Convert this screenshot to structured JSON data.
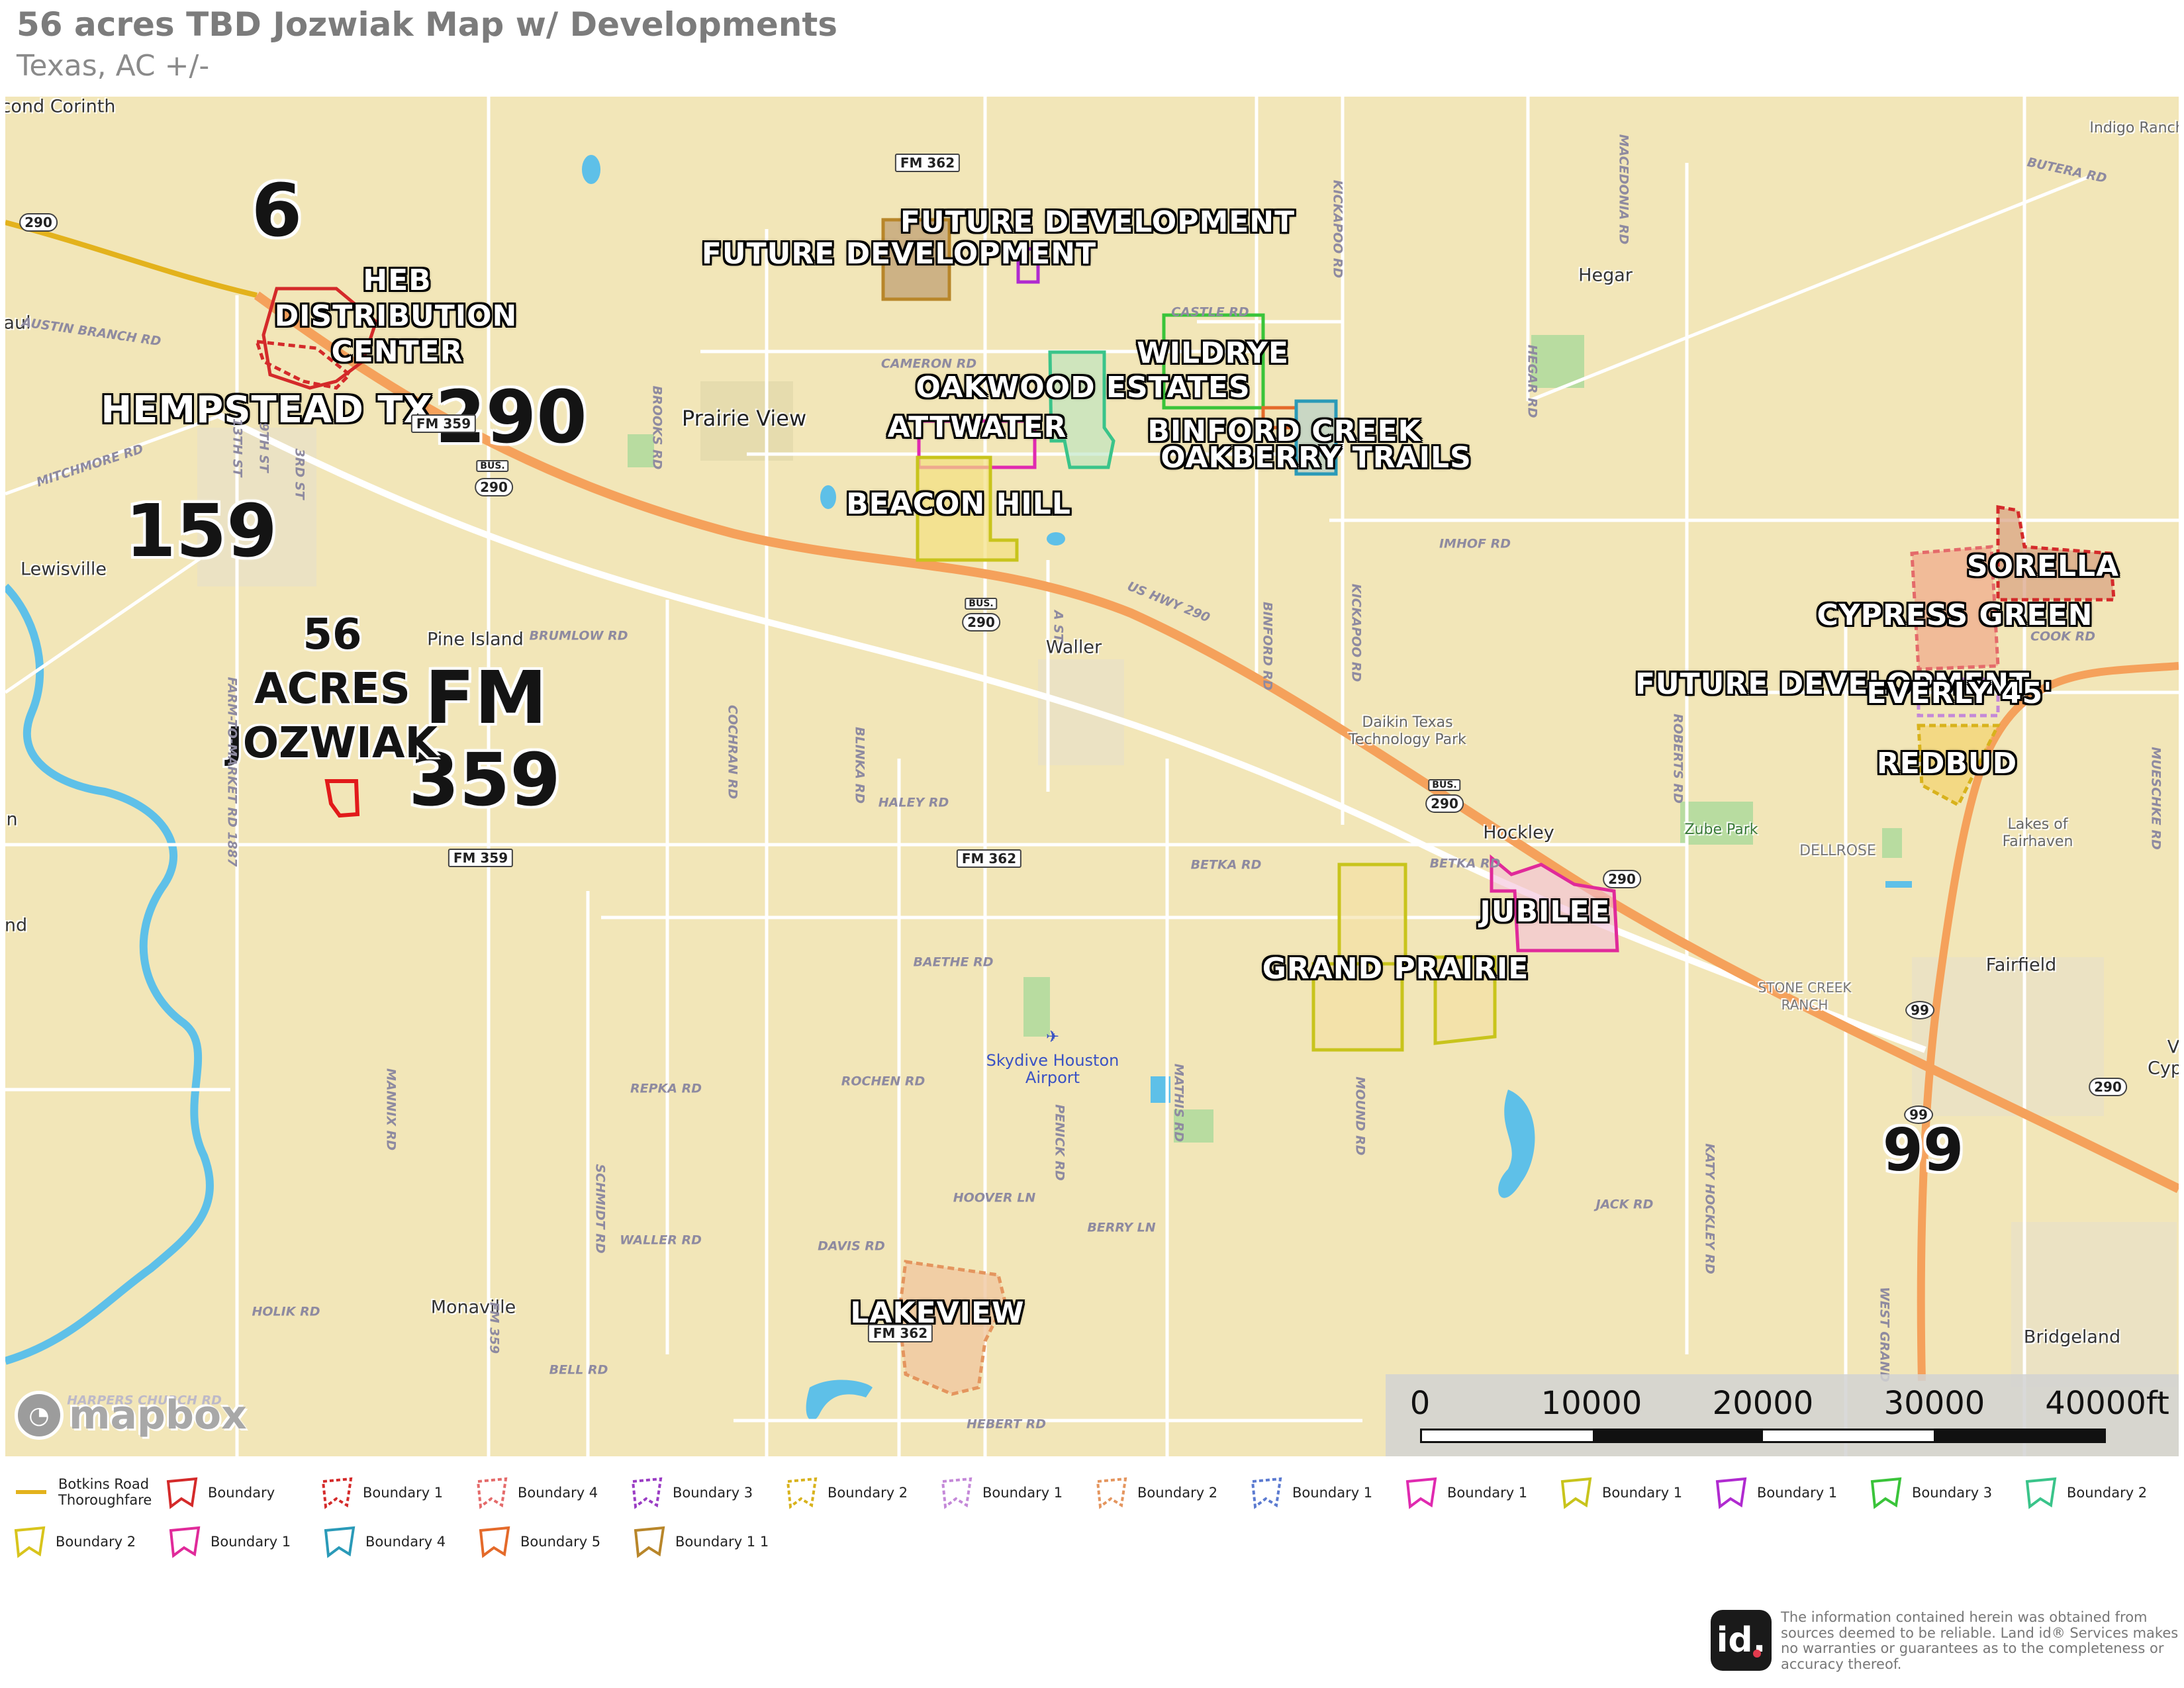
{
  "header": {
    "title": "56 acres TBD Jozwiak Map w/ Developments",
    "subtitle": "Texas,  AC +/-"
  },
  "map": {
    "colors": {
      "land": "#f2e6b8",
      "water": "#5ec0e8",
      "highway": "#f5a15b",
      "road": "#ffffff",
      "park": "#b8dca0"
    },
    "development_labels": [
      "FUTURE DEVELOPMENT",
      "FUTURE DEVELOPMENT",
      "HEB",
      "DISTRIBUTION",
      "CENTER",
      "HEMPSTEAD TX",
      "WILDRYE",
      "OAKWOOD ESTATES",
      "ATTWATER",
      "BINFORD CREEK",
      "OAKBERRY TRAILS",
      "BEACON HILL",
      "SORELLA",
      "CYPRESS GREEN",
      "FUTURE DEVELOPMENT",
      "EVERLY 45'",
      "REDBUD",
      "JUBILEE",
      "GRAND PRAIRIE",
      "LAKEVIEW"
    ],
    "highway_labels": [
      "6",
      "290",
      "159",
      "FM",
      "359",
      "99"
    ],
    "subject_label": [
      "56",
      "ACRES",
      "JOZWIAK"
    ],
    "place_labels": [
      "cond Corinth",
      "Hegar",
      "Indigo Ranch",
      "Prairie View",
      "Lewisville",
      "Pine Island",
      "Waller",
      "Daikin Texas",
      "Technology Park",
      "Hockley",
      "Zube Park",
      "Lakes of",
      "Fairhaven",
      "Fairfield",
      "Monaville",
      "Bridgeland",
      "DELLROSE",
      "STONE CREEK",
      "RANCH",
      "aul",
      "n",
      "nd",
      "Cyp",
      "V"
    ],
    "road_labels": [
      "AUSTIN BRANCH RD",
      "MITCHMORE RD",
      "CAMERON RD",
      "BROOKS RD",
      "BRUMLOW RD",
      "COCHRAN RD",
      "BLINKA RD",
      "HALEY RD",
      "BAETHE RD",
      "REPKA RD",
      "ROCHEN RD",
      "HOOVER LN",
      "DAVIS RD",
      "WALLER RD",
      "HOLIK RD",
      "BELL RD",
      "HEBERT RD",
      "HARPERS CHURCH RD",
      "MANNIX RD",
      "SCHMIDT RD",
      "BETKA RD",
      "BETKA RD",
      "IMHOF RD",
      "JACK RD",
      "BERRY LN",
      "MATHIS RD",
      "PENICK RD",
      "MOUND RD",
      "KICKAPOO RD",
      "KICKAPOO RD",
      "BINFORD RD",
      "HEGAR RD",
      "MACEDONIA RD",
      "BUTERA RD",
      "COOK RD",
      "ROBERTS RD",
      "KATY HOCKLEY RD",
      "MUESCHKE RD",
      "WEST GRAND",
      "US HWY 290",
      "FARM-TO-MARKET RD 1887",
      "FM 359",
      "13TH ST",
      "9TH ST",
      "3RD ST",
      "A ST",
      "CASTLE RD"
    ],
    "shields": [
      "FM 362",
      "FM 362",
      "FM 362",
      "FM 359",
      "FM 359",
      "290",
      "290",
      "290",
      "290",
      "290",
      "290",
      "99",
      "99",
      "BUS.",
      "BUS.",
      "BUS."
    ],
    "airport": [
      "Skydive Houston",
      "Airport"
    ],
    "attribution": "mapbox"
  },
  "scale_bar": {
    "ticks": [
      "0",
      "10000",
      "20000",
      "30000",
      "40000ft"
    ]
  },
  "legend": {
    "items": [
      {
        "label": "Botkins Road",
        "label2": "Thoroughfare",
        "color": "#e3b21c",
        "icon": "line-icon"
      },
      {
        "label": "Boundary",
        "color": "#d42a2a",
        "icon": "solid-polygon-icon"
      },
      {
        "label": "Boundary 1",
        "color": "#d42a2a",
        "icon": "dashed-polygon-icon"
      },
      {
        "label": "Boundary 4",
        "color": "#e46a6a",
        "icon": "dashed-polygon-icon"
      },
      {
        "label": "Boundary 3",
        "color": "#9a3cc4",
        "icon": "dashed-polygon-icon"
      },
      {
        "label": "Boundary 2",
        "color": "#d8b21c",
        "icon": "dashed-polygon-icon"
      },
      {
        "label": "Boundary 1",
        "color": "#c488d8",
        "icon": "dashed-polygon-icon"
      },
      {
        "label": "Boundary 2",
        "color": "#e4955e",
        "icon": "dashed-polygon-icon"
      },
      {
        "label": "Boundary 1",
        "color": "#5b7ad0",
        "icon": "dashed-polygon-icon"
      },
      {
        "label": "Boundary 1",
        "color": "#e02ab0",
        "icon": "solid-polygon-icon"
      },
      {
        "label": "Boundary 1",
        "color": "#c8c41c",
        "icon": "solid-polygon-icon"
      },
      {
        "label": "Boundary 1",
        "color": "#b02ad0",
        "icon": "solid-polygon-icon"
      },
      {
        "label": "Boundary 3",
        "color": "#3ac43a",
        "icon": "solid-polygon-icon"
      },
      {
        "label": "Boundary 2",
        "color": "#3ac48a",
        "icon": "solid-polygon-icon"
      },
      {
        "label": "Boundary 2",
        "color": "#d8c41c",
        "icon": "solid-polygon-icon"
      },
      {
        "label": "Boundary 1",
        "color": "#e02a9a",
        "icon": "solid-polygon-icon"
      },
      {
        "label": "Boundary 4",
        "color": "#2a9ab8",
        "icon": "solid-polygon-icon"
      },
      {
        "label": "Boundary 5",
        "color": "#e46a2a",
        "icon": "solid-polygon-icon"
      },
      {
        "label": "Boundary 1 1",
        "color": "#b8862a",
        "icon": "solid-polygon-icon"
      }
    ]
  },
  "footer": {
    "logo_text": "id.",
    "disclaimer": "The information contained herein was obtained from sources deemed to be reliable.  Land id® Services makes no warranties or guarantees as to the completeness or accuracy thereof."
  }
}
